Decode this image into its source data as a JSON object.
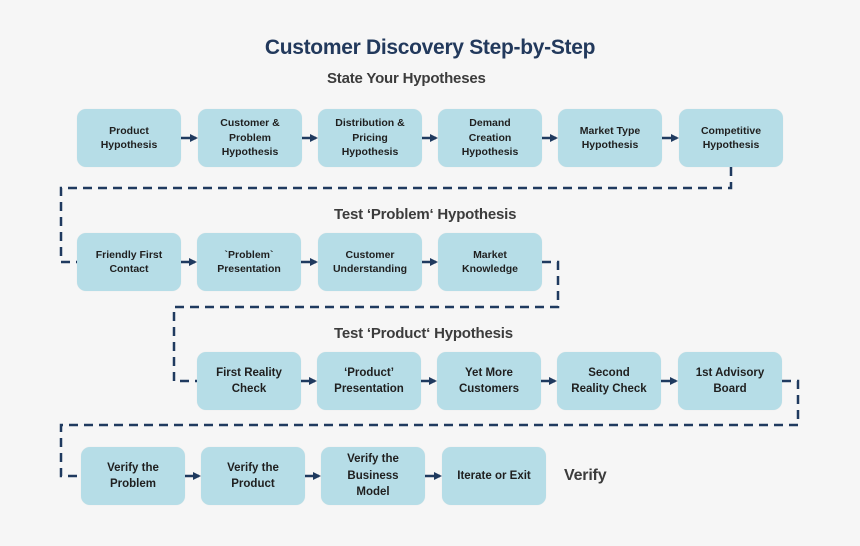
{
  "title": "Customer Discovery Step-by-Step",
  "colors": {
    "box_fill": "#b6dde7",
    "connector": "#1f3a5f",
    "title": "#22395c",
    "section_text": "#3c3c3c",
    "background": "#f6f6f6"
  },
  "sections": [
    {
      "label": "State Your Hypotheses",
      "steps": [
        "Product\nHypothesis",
        "Customer &\nProblem\nHypothesis",
        "Distribution &\nPricing\nHypothesis",
        "Demand\nCreation\nHypothesis",
        "Market Type\nHypothesis",
        "Competitive\nHypothesis"
      ]
    },
    {
      "label": "Test ‘Problem‘ Hypothesis",
      "steps": [
        "Friendly First\nContact",
        "`Problem`\nPresentation",
        "Customer\nUnderstanding",
        "Market\nKnowledge"
      ]
    },
    {
      "label": "Test ‘Product‘ Hypothesis",
      "steps": [
        "First Reality\nCheck",
        "‘Product’\nPresentation",
        "Yet More\nCustomers",
        "Second\nReality Check",
        "1st Advisory\nBoard"
      ]
    },
    {
      "label": "Verify",
      "steps": [
        "Verify the\nProblem",
        "Verify the\nProduct",
        "Verify the\nBusiness\nModel",
        "Iterate or Exit"
      ]
    }
  ]
}
